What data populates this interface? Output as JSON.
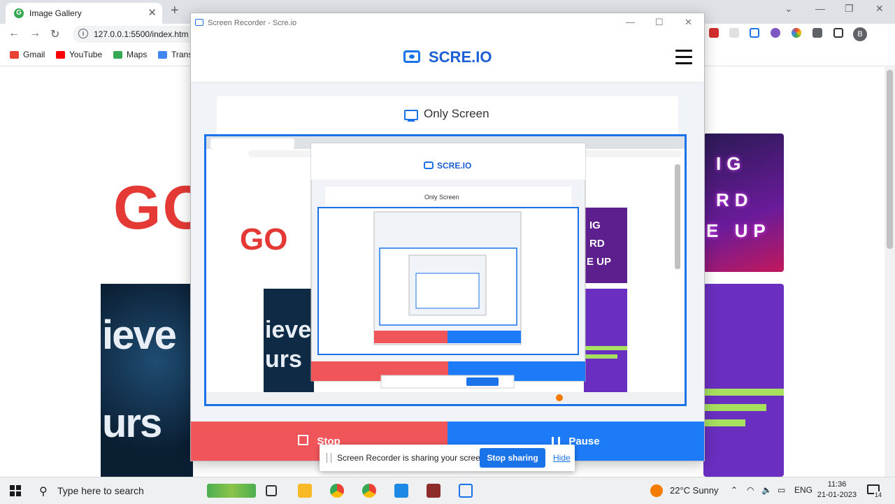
{
  "browser": {
    "tab_title": "Image Gallery",
    "url": "127.0.0.1:5500/index.htm",
    "avatar_initial": "B",
    "bookmarks": [
      {
        "label": "Gmail",
        "color": "#ea4335"
      },
      {
        "label": "YouTube",
        "color": "#ff0000"
      },
      {
        "label": "Maps",
        "color": "#34a853"
      },
      {
        "label": "Trans",
        "color": "#4285f4"
      }
    ]
  },
  "page": {
    "hero_text": "GO",
    "space_tile_text": [
      "ieve",
      "urs"
    ],
    "neon_tile_text": [
      "IG",
      "RD",
      "E UP"
    ]
  },
  "popup": {
    "window_title": "Screen Recorder - Scre.io",
    "brand": "SCRE.IO",
    "mode_label": "Only Screen",
    "stop_label": "Stop",
    "pause_label": "Pause"
  },
  "sharing_bar": {
    "message": "Screen Recorder is sharing your screen.",
    "stop_sharing_label": "Stop sharing",
    "hide_label": "Hide"
  },
  "taskbar": {
    "search_placeholder": "Type here to search",
    "weather": "22°C  Sunny",
    "language": "ENG",
    "time": "11:36",
    "date": "21-01-2023",
    "notification_count": "14"
  },
  "colors": {
    "accent": "#1a73e8",
    "stop": "#f0555a",
    "pause": "#1e7bf7"
  }
}
